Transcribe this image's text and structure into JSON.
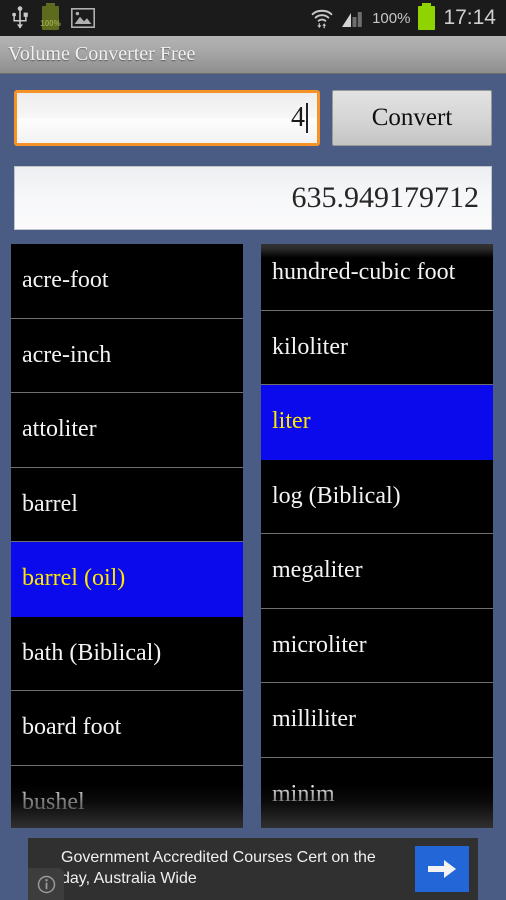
{
  "statusbar": {
    "left_icons": [
      "usb-icon",
      "battery-charging-icon",
      "gallery-image-icon"
    ],
    "battery_left_label": "100%",
    "right_icons": [
      "wifi-icon",
      "cellular-signal-icon",
      "battery-icon"
    ],
    "battery_percent": "100%",
    "clock": "17:14"
  },
  "titlebar": {
    "title": "Volume Converter Free"
  },
  "converter": {
    "amount_value": "4",
    "amount_placeholder": "",
    "convert_label": "Convert",
    "result_value": "635.949179712"
  },
  "from_list": {
    "selected": "barrel (oil)",
    "items": [
      "acre-foot",
      "acre-inch",
      "attoliter",
      "barrel",
      "barrel (oil)",
      "bath (Biblical)",
      "board foot",
      "bushel"
    ]
  },
  "to_list": {
    "selected": "liter",
    "items": [
      "hundred-cubic foot",
      "kiloliter",
      "liter",
      "log (Biblical)",
      "megaliter",
      "microliter",
      "milliliter",
      "minim"
    ]
  },
  "ad": {
    "text": "Government Accredited Courses Cert on the day, Australia Wide",
    "arrow_icon": "arrow-right-icon",
    "info_icon": "info-icon"
  },
  "colors": {
    "background": "#4b5c84",
    "selection": "#0a0aed",
    "selection_text": "#ffe800",
    "focus_border": "#f79226",
    "ad_accent": "#2266d8",
    "battery_green": "#8fd400"
  }
}
